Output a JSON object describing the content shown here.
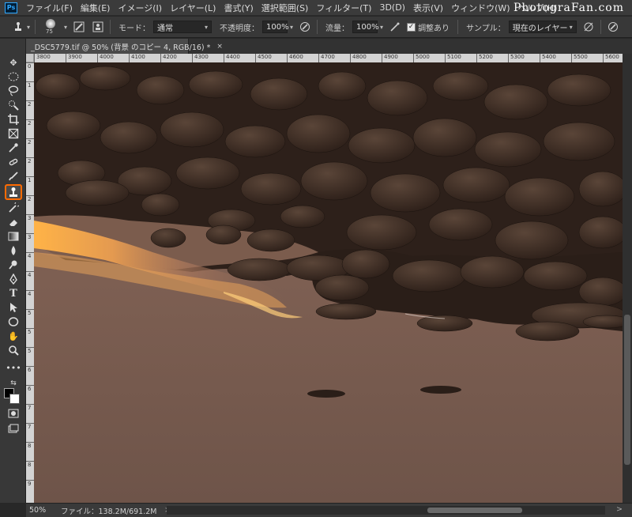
{
  "menubar": {
    "logo": "Ps",
    "items": [
      "ファイル(F)",
      "編集(E)",
      "イメージ(I)",
      "レイヤー(L)",
      "書式(Y)",
      "選択範囲(S)",
      "フィルター(T)",
      "3D(D)",
      "表示(V)",
      "ウィンドウ(W)",
      "ヘルプ(H)"
    ],
    "brand": "PhotograFan.com"
  },
  "options": {
    "brush_size": "75",
    "mode_label": "モード：",
    "mode_value": "通常",
    "opacity_label": "不透明度：",
    "opacity_value": "100%",
    "flow_label": "流量：",
    "flow_value": "100%",
    "aligned_label": "調整あり",
    "aligned_checked": true,
    "sample_label": "サンプル：",
    "sample_value": "現在のレイヤー"
  },
  "document": {
    "tab_title": "_DSC5779.tif @ 50% (背景 のコピー 4, RGB/16) *",
    "tab_close": "×"
  },
  "ruler": {
    "h_labels": [
      "3800",
      "3900",
      "4000",
      "4100",
      "4200",
      "4300",
      "4400",
      "4500",
      "4600",
      "4700",
      "4800",
      "4900",
      "5000",
      "5100",
      "5200",
      "5300",
      "5400",
      "5500",
      "5600"
    ],
    "v_labels": [
      "0",
      "1",
      "2",
      "2",
      "2",
      "2",
      "1",
      "2",
      "3",
      "3",
      "4",
      "4",
      "4",
      "5",
      "5",
      "5",
      "6",
      "6",
      "7",
      "7",
      "8",
      "8",
      "9"
    ]
  },
  "toolbar": {
    "active_tool": "clone-stamp",
    "foreground_color": "#000000",
    "background_color": "#ffffff",
    "highlight_color": "#ff6a00"
  },
  "status": {
    "zoom": "50%",
    "file_info": "ファイル：138.2M/691.2M",
    "arrow": ">",
    "left_arrow": "<",
    "right_arrow": ">"
  }
}
